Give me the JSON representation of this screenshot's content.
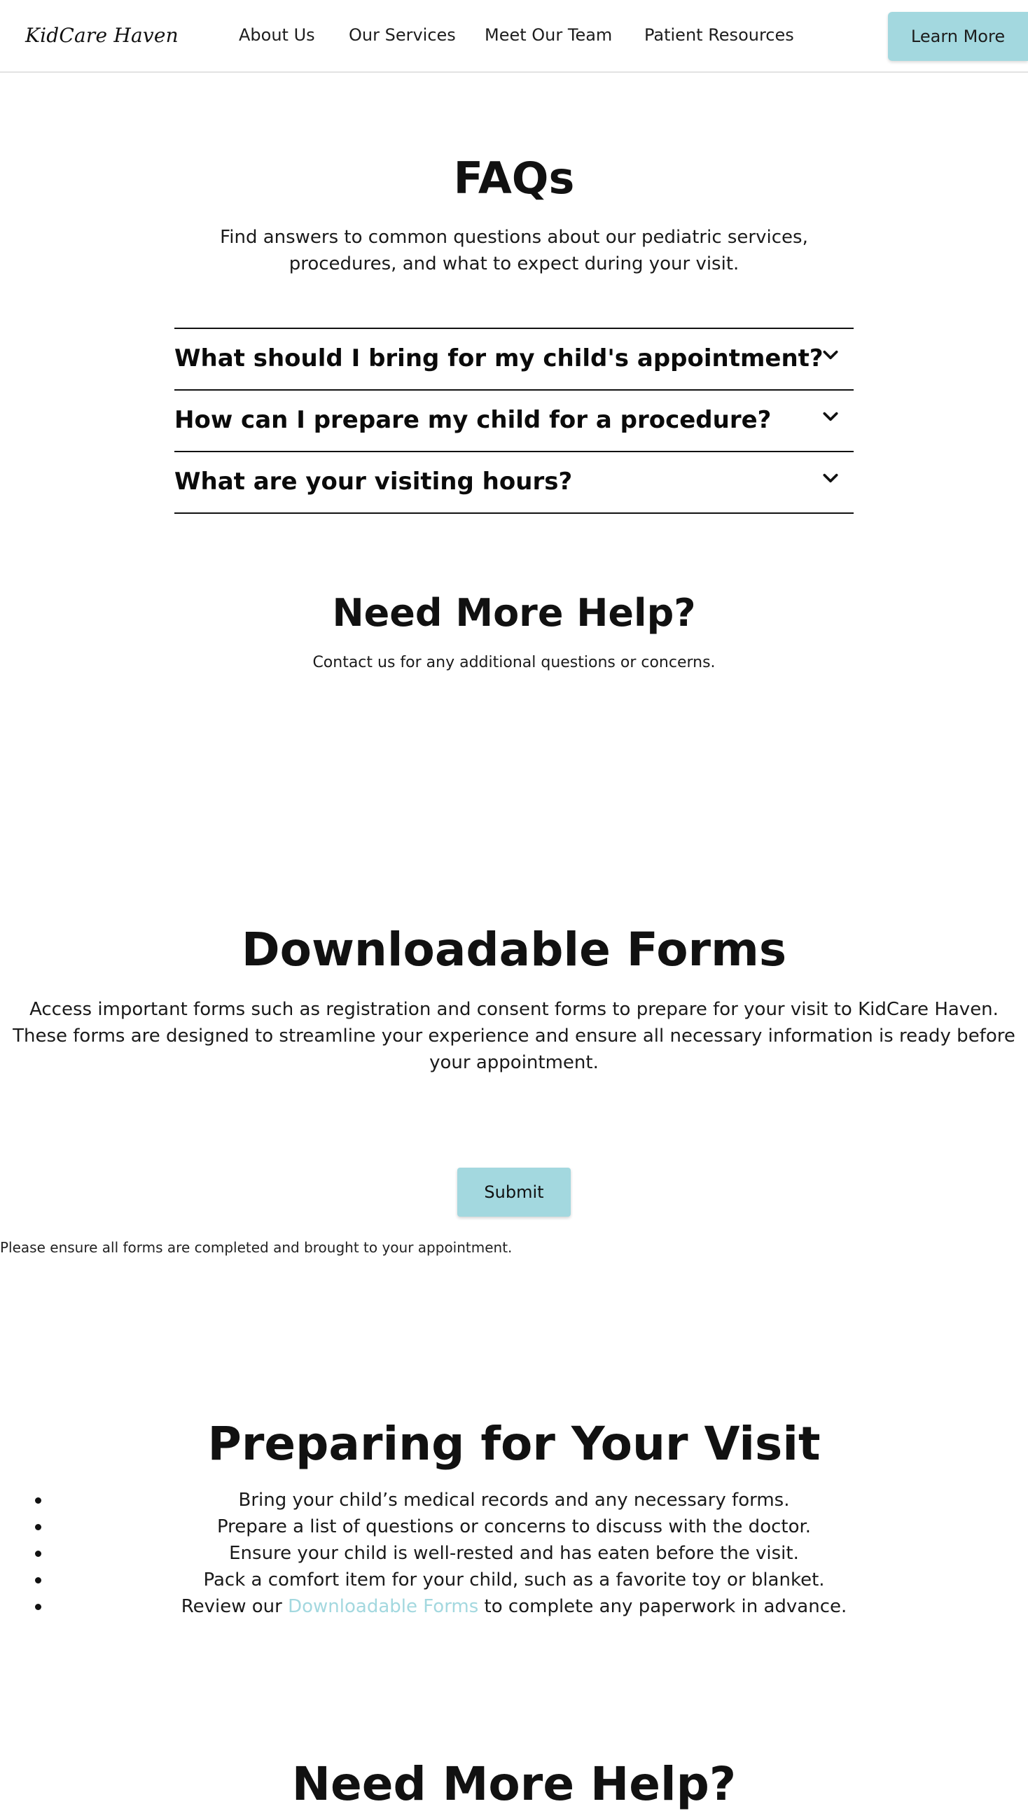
{
  "header": {
    "brand": "KidCare Haven",
    "nav": [
      "About Us",
      "Our Services",
      "Meet Our Team",
      "Patient Resources"
    ],
    "cta_label": "Learn More"
  },
  "faqs": {
    "title": "FAQs",
    "subtitle": "Find answers to common questions about our pediatric services, procedures, and what to expect during your visit.",
    "items": [
      {
        "question": "What should I bring for my child's appointment?"
      },
      {
        "question": "How can I prepare my child for a procedure?"
      },
      {
        "question": "What are your visiting hours?"
      }
    ]
  },
  "help": {
    "title": "Need More Help?",
    "subtitle": "Contact us for any additional questions or concerns."
  },
  "forms": {
    "title": "Downloadable Forms",
    "description": "Access important forms such as registration and consent forms to prepare for your visit to KidCare Haven. These forms are designed to streamline your experience and ensure all necessary information is ready before your appointment.",
    "submit_label": "Submit",
    "note": "Please ensure all forms are completed and brought to your appointment."
  },
  "prepare": {
    "title": "Preparing for Your Visit",
    "items": [
      "Bring your child’s medical records and any necessary forms.",
      "Prepare a list of questions or concerns to discuss with the doctor.",
      "Ensure your child is well-rested and has eaten before the visit.",
      "Pack a comfort item for your child, such as a favorite toy or blanket."
    ],
    "last_item": {
      "prefix": "Review our ",
      "link_text": "Downloadable Forms",
      "suffix": " to complete any paperwork in advance."
    }
  },
  "help_bottom": {
    "title": "Need More Help?"
  },
  "colors": {
    "accent": "#a3d8df",
    "text": "#111111"
  }
}
